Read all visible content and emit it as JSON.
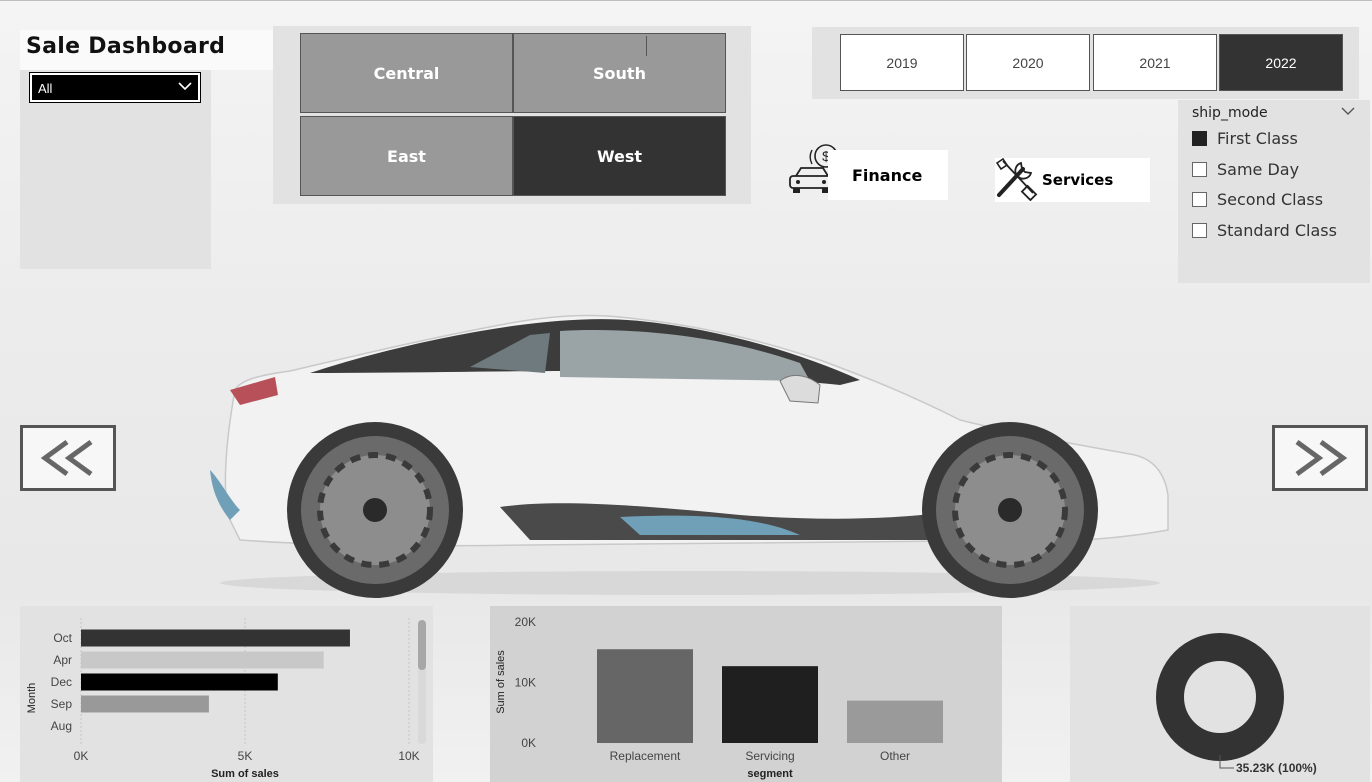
{
  "header": {
    "title": "Sale Dashboard"
  },
  "category_filter": {
    "value": "All"
  },
  "regions": [
    {
      "label": "Central",
      "selected": false
    },
    {
      "label": "South",
      "selected": false
    },
    {
      "label": "East",
      "selected": false
    },
    {
      "label": "West",
      "selected": true
    }
  ],
  "years": [
    {
      "label": "2019",
      "selected": false
    },
    {
      "label": "2020",
      "selected": false
    },
    {
      "label": "2021",
      "selected": false
    },
    {
      "label": "2022",
      "selected": true
    }
  ],
  "nav_links": {
    "finance": "Finance",
    "services": "Services"
  },
  "ship_mode": {
    "title": "ship_mode",
    "options": [
      {
        "label": "First Class",
        "checked": true
      },
      {
        "label": "Same Day",
        "checked": false
      },
      {
        "label": "Second Class",
        "checked": false
      },
      {
        "label": "Standard Class",
        "checked": false
      }
    ]
  },
  "chart_data": [
    {
      "type": "bar",
      "orientation": "horizontal",
      "categories": [
        "Oct",
        "Apr",
        "Dec",
        "Sep",
        "Aug"
      ],
      "values": [
        8200,
        7400,
        6000,
        3900,
        null
      ],
      "colors": [
        "#333333",
        "#c8c8c8",
        "#000000",
        "#999999",
        "#cccccc"
      ],
      "xlabel": "Sum of sales",
      "ylabel": "Month",
      "xlim": [
        0,
        10000
      ],
      "xticks": [
        "0K",
        "5K",
        "10K"
      ],
      "grid": true
    },
    {
      "type": "bar",
      "categories": [
        "Replacement",
        "Servicing",
        "Other"
      ],
      "values": [
        15500,
        12700,
        7000
      ],
      "colors": [
        "#666666",
        "#1f1f1f",
        "#9a9a9a"
      ],
      "xlabel": "segment",
      "ylabel": "Sum of sales",
      "ylim": [
        0,
        20000
      ],
      "yticks": [
        "0K",
        "10K",
        "20K"
      ]
    },
    {
      "type": "pie",
      "style": "donut",
      "values": [
        35230
      ],
      "color": "#333333",
      "label": "35.23K (100%)"
    }
  ]
}
